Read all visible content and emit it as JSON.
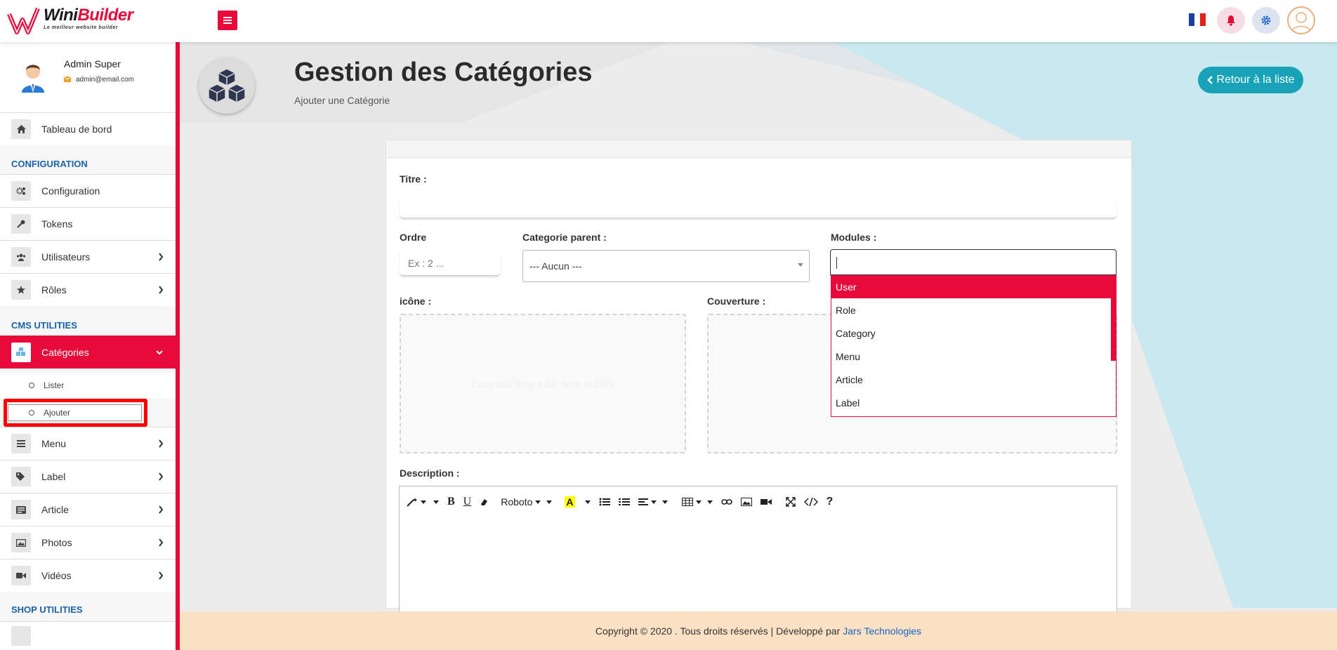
{
  "brand": {
    "name_part1": "Wini",
    "name_part2": "Builder",
    "tagline": "Le meilleur website builder",
    "accent_color": "#e8093b"
  },
  "topbar": {
    "menu_icon": "hamburger-icon",
    "language_flag": "france-flag",
    "notification_icon": "bell-icon",
    "settings_icon": "gear-icon",
    "avatar_icon": "user-avatar-icon"
  },
  "sidebar": {
    "profile": {
      "name": "Admin Super",
      "email": "admin@email.com"
    },
    "dashboard": {
      "label": "Tableau de bord",
      "icon": "home-icon"
    },
    "sections": {
      "configuration": "CONFIGURATION",
      "cms": "CMS UTILITIES",
      "shop": "SHOP UTILITIES"
    },
    "config_items": [
      {
        "label": "Configuration",
        "icon": "cogs-icon"
      },
      {
        "label": "Tokens",
        "icon": "key-icon"
      },
      {
        "label": "Utilisateurs",
        "icon": "users-icon"
      },
      {
        "label": "Rôles",
        "icon": "star-icon"
      }
    ],
    "cms_items": [
      {
        "label": "Catégories",
        "icon": "cubes-icon",
        "active": true
      },
      {
        "label": "Menu",
        "icon": "bars-icon"
      },
      {
        "label": "Label",
        "icon": "tags-icon"
      },
      {
        "label": "Article",
        "icon": "newspaper-icon"
      },
      {
        "label": "Photos",
        "icon": "image-icon"
      },
      {
        "label": "Vidéos",
        "icon": "video-icon"
      }
    ],
    "category_sub_items": [
      {
        "label": "Lister"
      },
      {
        "label": "Ajouter"
      }
    ]
  },
  "header": {
    "title": "Gestion des Catégories",
    "subtitle": "Ajouter une Catégorie",
    "back_button": "Retour à la liste"
  },
  "form": {
    "titre_label": "Titre :",
    "ordre_label": "Ordre",
    "ordre_placeholder": "Ex : 2 ...",
    "parent_label": "Categorie parent :",
    "parent_value": "--- Aucun ---",
    "modules_label": "Modules :",
    "modules_options": [
      "User",
      "Role",
      "Category",
      "Menu",
      "Article",
      "Label"
    ],
    "modules_highlighted": "User",
    "icone_label": "icône :",
    "couverture_label": "Couverture :",
    "dropzone_text": "Drag and drop a file here or click",
    "description_label": "Description :",
    "editor_font": "Roboto"
  },
  "footer": {
    "text": "Copyright © 2020 . Tous droits réservés | Développé par",
    "link": "Jars Technologies"
  }
}
